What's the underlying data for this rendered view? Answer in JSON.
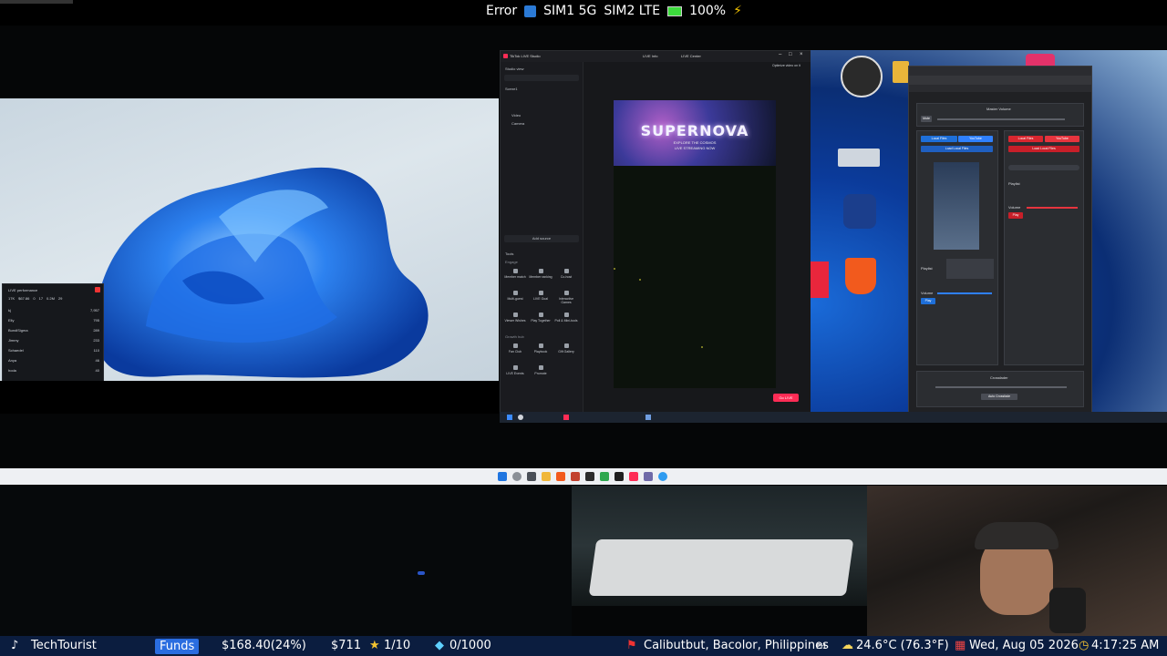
{
  "status_bar": {
    "error": "Error",
    "sim1": "SIM1 5G",
    "sim2": "SIM2 LTE",
    "battery": "100%"
  },
  "live_performance": {
    "title": "LIVE performance",
    "stats": [
      "17K",
      "$67.86",
      "0",
      "17",
      "0.2M",
      "29"
    ],
    "rows": [
      {
        "name": "kj",
        "value": "7,957"
      },
      {
        "name": "Elly",
        "value": "795"
      },
      {
        "name": "BundlSigma",
        "value": "289"
      },
      {
        "name": "Jimmy",
        "value": "233"
      },
      {
        "name": "Schaedel",
        "value": "110"
      },
      {
        "name": "Anya",
        "value": "46"
      },
      {
        "name": "hoda",
        "value": "40"
      }
    ]
  },
  "studio": {
    "app_title": "TikTok LIVE Studio",
    "live_info": "LIVE Info",
    "live_center": "LIVE Center",
    "studio_view": "Studio view",
    "scene_label": "Scene1",
    "sources": [
      "Video",
      "Camera"
    ],
    "add_source": "Add source",
    "tools_label": "Tools",
    "engage_label": "Engage",
    "tools": [
      "Member match",
      "Member ranking",
      "Co-host",
      "Multi-guest",
      "LIVE Goal",
      "Interactive Games",
      "Viewer Wishes",
      "Play Together",
      "Poll & Mini-tools"
    ],
    "growth_label": "Growth hub",
    "growth_tools": [
      "Fan Club",
      "Playbook",
      "Gift Gallery",
      "LIVE Events",
      "Promote"
    ],
    "banner_title": "SUPERNOVA",
    "banner_sub": "EXPLORE THE COSMOS",
    "banner_sub2": "LIVE STREAMING NOW",
    "go_live": "Go LIVE",
    "optimize": "Optimize video on it"
  },
  "browser": {
    "master_volume": "Master Volume",
    "mute": "Mute",
    "left_tabs": [
      "Local Files",
      "YouTube"
    ],
    "left_button": "Load Local Files",
    "right_tabs": [
      "Local Files",
      "YouTube"
    ],
    "right_button": "Load Local Files",
    "playlist_label": "Playlist",
    "volume_label": "Volume",
    "crossfader": "Crossfader",
    "auto_crossfade": "Auto Crossfade",
    "deck_left": "Play",
    "deck_right": "Play"
  },
  "ticker": {
    "channel": "TechTourist",
    "funds_label": "Funds",
    "funds_value": "$168.40(24%)",
    "amount": "$711",
    "stars": "1/10",
    "diamonds": "0/1000",
    "location": "Calibutbut, Bacolor, Philippines",
    "country": "PH",
    "weather": "24.6°C (76.3°F)",
    "date": "Wed, Aug 05 2026",
    "time": "4:17:25 AM"
  },
  "colors": {
    "accent_red": "#fe2c55",
    "ticker_bg": "#0b1d3f",
    "funds_blue": "#2a6de0",
    "battery_green": "#3ddc3d"
  }
}
